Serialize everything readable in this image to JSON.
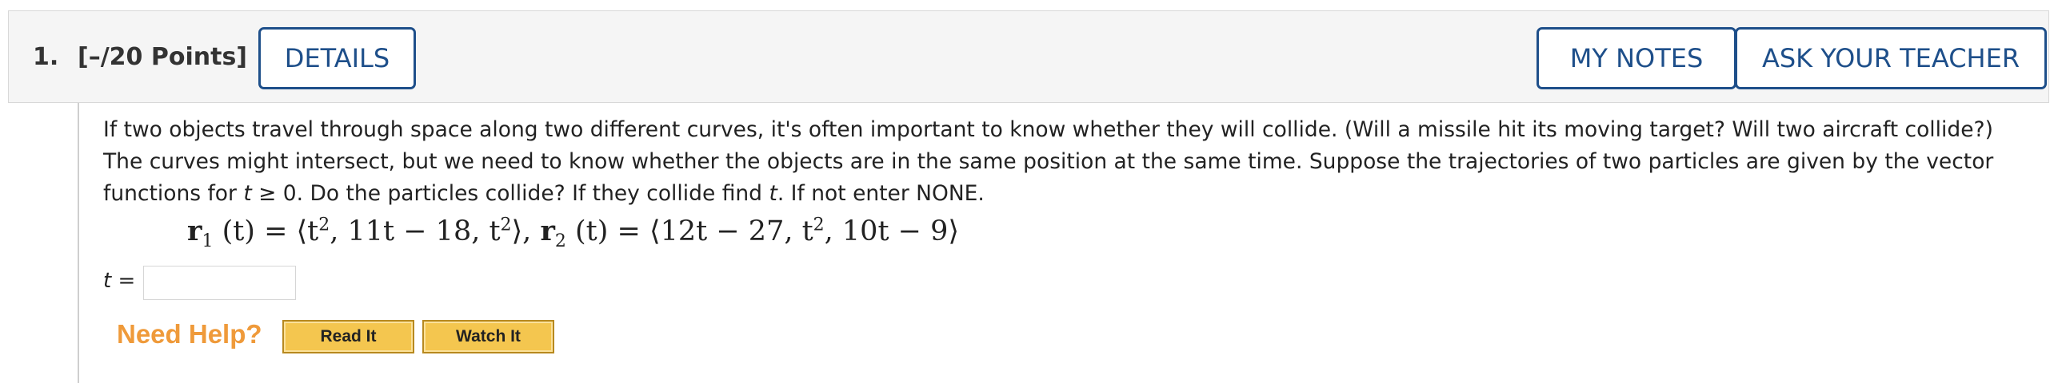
{
  "header": {
    "question_number": "1.",
    "points": "[–/20 Points]",
    "details_label": "DETAILS",
    "my_notes_label": "MY NOTES",
    "ask_teacher_label": "ASK YOUR TEACHER"
  },
  "question": {
    "prompt_1": "If two objects travel through space along two different curves, it's often important to know whether they will collide. (Will a missile hit its moving target? Will two aircraft collide?) The curves might intersect, but we need to know whether the objects are in the same position at the same time. Suppose the trajectories of two particles are given by the vector functions for ",
    "prompt_var": "t",
    "prompt_2": " ≥ 0. Do the particles collide? If they collide find ",
    "prompt_3": ". If not enter NONE.",
    "r1_label": "r",
    "r1_sub": "1",
    "r1_body_a": " (t) = ⟨t",
    "sq": "2",
    "r1_body_b": ", 11t − 18, t",
    "r1_body_c": "⟩, ",
    "r2_label": "r",
    "r2_sub": "2",
    "r2_body_a": " (t) = ⟨12t − 27, t",
    "r2_body_b": ", 10t − 9⟩"
  },
  "answer": {
    "label_var": "t",
    "label_eq": " =",
    "value": ""
  },
  "help": {
    "need_help": "Need Help?",
    "read_it": "Read It",
    "watch_it": "Watch It"
  }
}
